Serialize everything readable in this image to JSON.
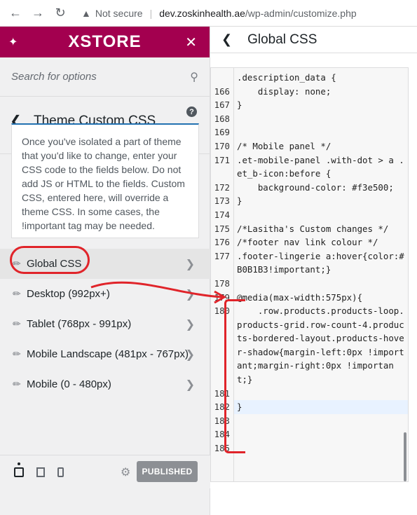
{
  "browser": {
    "security_label": "Not secure",
    "url_host": "dev.zoskinhealth.ae",
    "url_path": "/wp-admin/customize.php"
  },
  "sidebar": {
    "brand": "XSTORE",
    "search_placeholder": "Search for options",
    "section_title": "Theme Custom CSS",
    "description": "Once you've isolated a part of theme that you'd like to change, enter your CSS code to the fields below. Do not add JS or HTML to the fields. Custom CSS, entered here, will override a theme CSS. In some cases, the !important tag may be needed.",
    "items": [
      {
        "label": "Global CSS"
      },
      {
        "label": "Desktop (992px+)"
      },
      {
        "label": "Tablet (768px - 991px)"
      },
      {
        "label": "Mobile Landscape (481px - 767px)"
      },
      {
        "label": "Mobile (0 - 480px)"
      }
    ],
    "publish_label": "PUBLISHED"
  },
  "editor": {
    "title": "Global CSS",
    "lines": [
      {
        "num": "",
        "text": ".description_data {"
      },
      {
        "num": "166",
        "text": "    display: none;"
      },
      {
        "num": "167",
        "text": "}"
      },
      {
        "num": "168",
        "text": ""
      },
      {
        "num": "169",
        "text": ""
      },
      {
        "num": "170",
        "text": "/* Mobile panel */"
      },
      {
        "num": "171",
        "text": ".et-mobile-panel .with-dot > a .et_b-icon:before {"
      },
      {
        "num": "172",
        "text": "    background-color: #f3e500;"
      },
      {
        "num": "173",
        "text": "}"
      },
      {
        "num": "174",
        "text": ""
      },
      {
        "num": "175",
        "text": "/*Lasitha's Custom changes */"
      },
      {
        "num": "176",
        "text": "/*footer nav link colour */"
      },
      {
        "num": "177",
        "text": ".footer-lingerie a:hover{color:#B0B1B3!important;}"
      },
      {
        "num": "178",
        "text": ""
      },
      {
        "num": "179",
        "text": "@media(max-width:575px){"
      },
      {
        "num": "180",
        "text": "    .row.products.products-loop.products-grid.row-count-4.products-bordered-layout.products-hover-shadow{margin-left:0px !important;margin-right:0px !important;}"
      },
      {
        "num": "181",
        "text": ""
      },
      {
        "num": "182",
        "text": "}"
      },
      {
        "num": "183",
        "text": ""
      },
      {
        "num": "184",
        "text": ""
      },
      {
        "num": "185",
        "text": ""
      }
    ]
  }
}
